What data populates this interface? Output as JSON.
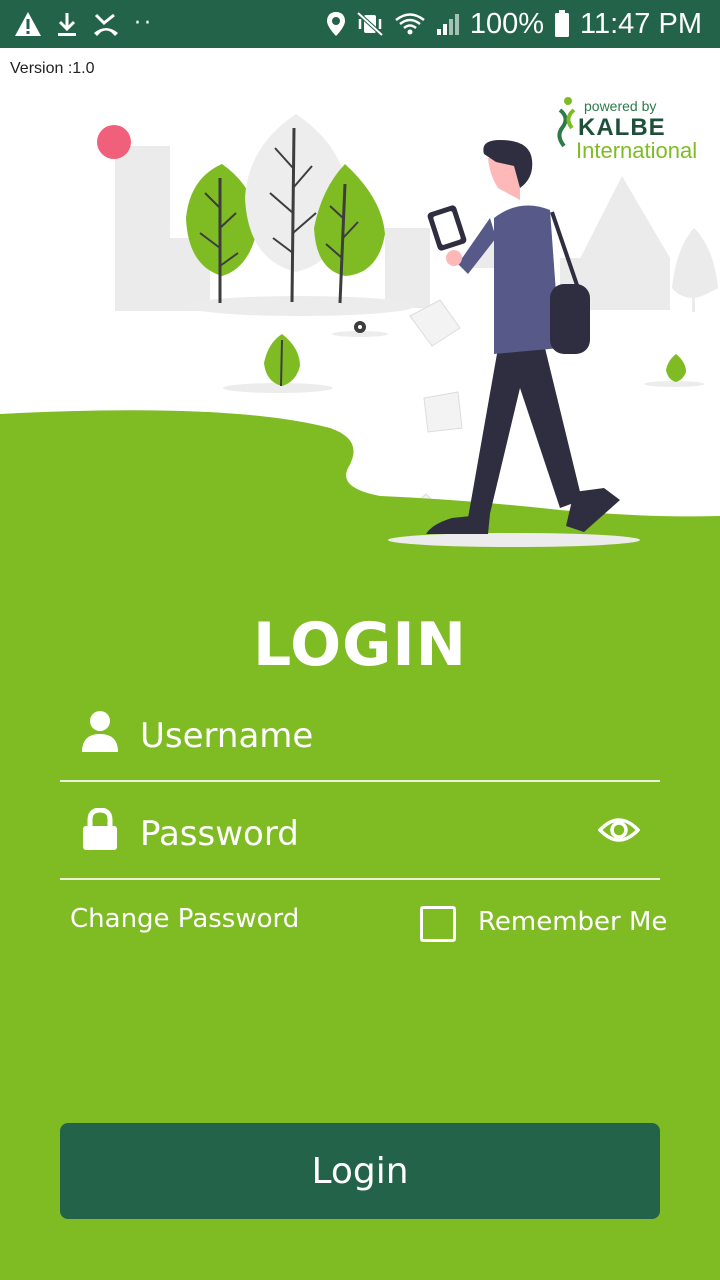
{
  "status_bar": {
    "battery": "100%",
    "time": "11:47 PM",
    "icons": [
      "warning-icon",
      "download-icon",
      "missed-call-icon",
      "more-notifications-icon",
      "location-icon",
      "mute-vibrate-icon",
      "wifi-icon",
      "signal-icon",
      "battery-icon"
    ]
  },
  "app": {
    "version": "Version :1.0",
    "logo": {
      "powered_by": "powered by",
      "brand": "KALBE",
      "sub": "International"
    }
  },
  "form": {
    "title": "LOGIN",
    "username": {
      "placeholder": "Username",
      "value": ""
    },
    "password": {
      "placeholder": "Password",
      "value": ""
    },
    "change_password": "Change Password",
    "remember_me": "Remember Me",
    "remember_checked": false,
    "submit": "Login"
  },
  "colors": {
    "primary_green": "#7fbc24",
    "dark_green": "#22634a"
  }
}
